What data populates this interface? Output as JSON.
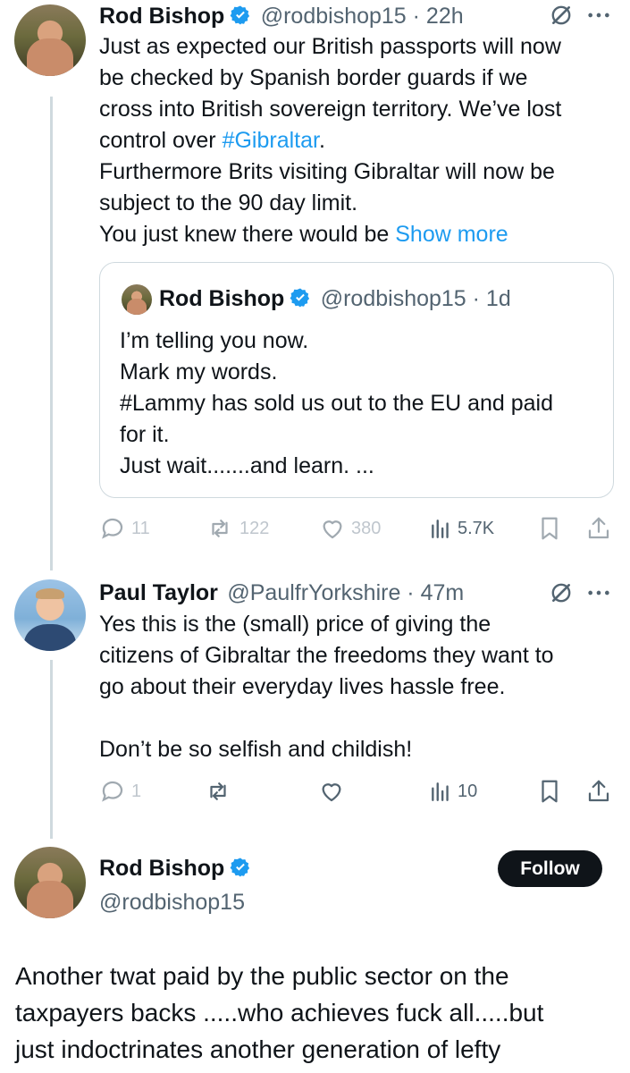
{
  "colors": {
    "link": "#1d9bf0",
    "text": "#0f1419",
    "secondary": "#536471",
    "verified": "#1d9bf0",
    "follow_bg": "#0f1419"
  },
  "tweet1": {
    "author_name": "Rod Bishop",
    "author_meta": "@rodbishop15 · 22h",
    "lines": [
      "Just as expected our British passports will now",
      "be checked by Spanish border guards if we",
      "cross into British sovereign territory. We’ve lost"
    ],
    "line4_prefix": "control over ",
    "line4_hashtag": "#Gibraltar",
    "line4_suffix": ".",
    "line5": "Furthermore Brits visiting Gibraltar will now be",
    "line6": "subject to the 90 day limit.",
    "line7_prefix": "You just knew there would be ",
    "show_more": "Show more",
    "icons": [
      "grok-icon",
      "more-icon"
    ],
    "metrics": {
      "replies": "11",
      "reposts": "122",
      "likes": "380",
      "views": "5.7K"
    }
  },
  "quote": {
    "author_name": "Rod Bishop",
    "author_meta": "@rodbishop15 · 1d",
    "lines": [
      "I’m telling you now.",
      "Mark my words.",
      "#Lammy has sold us out to the EU and paid",
      "for it.",
      "Just wait.......and learn. ..."
    ]
  },
  "tweet2": {
    "author_name": "Paul Taylor",
    "author_meta": "@PaulfrYorkshire · 47m",
    "lines": [
      "Yes this is the (small) price of giving the",
      "citizens of Gibraltar the freedoms they want to",
      "go about their everyday lives hassle free."
    ],
    "line_after_blank": "Don’t be so selfish and childish!",
    "metrics": {
      "replies": "1",
      "views": "10"
    }
  },
  "tweet3": {
    "author_name": "Rod Bishop",
    "author_handle": "@rodbishop15",
    "follow_label": "Follow",
    "lines": [
      "Another twat paid by the public sector on the",
      "taxpayers backs .....who achieves fuck all.....but",
      "just indoctrinates another generation of lefty"
    ]
  }
}
